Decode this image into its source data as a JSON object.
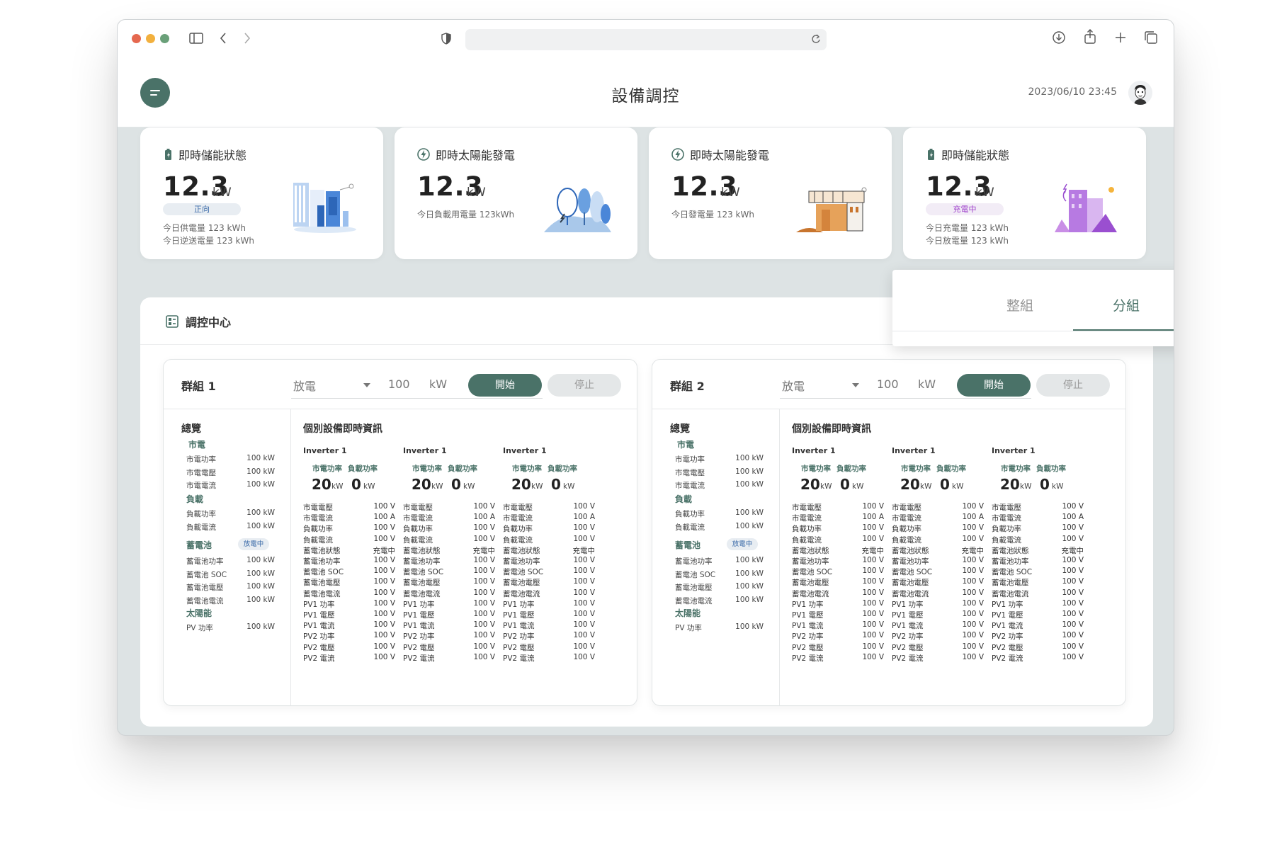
{
  "app": {
    "title": "設備調控",
    "datetime": "2023/06/10 23:45"
  },
  "colors": {
    "accent": "#4a7268",
    "badge_blue": "#3a6aa8",
    "badge_purple": "#a044cc"
  },
  "cards": [
    {
      "title": "即時儲能狀態",
      "icon": "battery-icon",
      "value": "12.3",
      "unit": "kW",
      "badge": "正向",
      "lines": [
        "今日供電量 123 kWh",
        "今日逆送電量 123 kWh"
      ]
    },
    {
      "title": "即時太陽能發電",
      "icon": "lightning-icon",
      "value": "12.3",
      "unit": "kW",
      "badge": "",
      "lines": [
        "今日負載用電量 123kWh"
      ]
    },
    {
      "title": "即時太陽能發電",
      "icon": "lightning-icon",
      "value": "12.3",
      "unit": "kW",
      "badge": "",
      "lines": [
        "今日發電量 123 kWh"
      ]
    },
    {
      "title": "即時儲能狀態",
      "icon": "battery-icon",
      "value": "12.3",
      "unit": "kW",
      "badge": "充電中",
      "lines": [
        "今日充電量 123 kWh",
        "今日放電量 123 kWh"
      ]
    }
  ],
  "panel": {
    "title": "調控中心",
    "tabs": [
      "整組",
      "分組"
    ],
    "active_tab": "分組"
  },
  "groups": [
    {
      "name": "群組 1",
      "mode": "放電",
      "power": "100",
      "unit": "kW",
      "start_label": "開始",
      "stop_label": "停止",
      "overview": {
        "title": "總覽",
        "grid_title": "市電",
        "grid": [
          [
            "市電功率",
            "100 kW"
          ],
          [
            "市電電壓",
            "100 kW"
          ],
          [
            "市電電流",
            "100 kW"
          ]
        ],
        "load_title": "負載",
        "load": [
          [
            "負載功率",
            "100 kW"
          ],
          [
            "負載電流",
            "100 kW"
          ]
        ],
        "battery_title": "蓄電池",
        "battery_badge": "放電中",
        "battery": [
          [
            "蓄電池功率",
            "100 kW"
          ],
          [
            "蓄電池 SOC",
            "100 kW"
          ],
          [
            "蓄電池電壓",
            "100 kW"
          ],
          [
            "蓄電池電流",
            "100 kW"
          ]
        ],
        "solar_title": "太陽能",
        "solar": [
          [
            "PV 功率",
            "100 kW"
          ]
        ]
      },
      "devices_title": "個別設備即時資訊",
      "inverters": [
        {
          "name": "Inverter 1",
          "grid_label": "市電功率",
          "load_label": "負載功率",
          "grid_value": "20",
          "load_value": "0",
          "unit": "kW",
          "rows": [
            [
              "市電電壓",
              "100 V"
            ],
            [
              "市電電流",
              "100 A"
            ],
            [
              "負載功率",
              "100 V"
            ],
            [
              "負載電流",
              "100 V"
            ],
            [
              "蓄電池狀態",
              "充電中"
            ],
            [
              "蓄電池功率",
              "100 V"
            ],
            [
              "蓄電池 SOC",
              "100 V"
            ],
            [
              "蓄電池電壓",
              "100 V"
            ],
            [
              "蓄電池電流",
              "100 V"
            ],
            [
              "PV1 功率",
              "100 V"
            ],
            [
              "PV1 電壓",
              "100 V"
            ],
            [
              "PV1 電流",
              "100 V"
            ],
            [
              "PV2 功率",
              "100 V"
            ],
            [
              "PV2 電壓",
              "100 V"
            ],
            [
              "PV2 電流",
              "100 V"
            ]
          ]
        },
        {
          "name": "Inverter 1",
          "grid_label": "市電功率",
          "load_label": "負載功率",
          "grid_value": "20",
          "load_value": "0",
          "unit": "kW",
          "rows": [
            [
              "市電電壓",
              "100 V"
            ],
            [
              "市電電流",
              "100 A"
            ],
            [
              "負載功率",
              "100 V"
            ],
            [
              "負載電流",
              "100 V"
            ],
            [
              "蓄電池狀態",
              "充電中"
            ],
            [
              "蓄電池功率",
              "100 V"
            ],
            [
              "蓄電池 SOC",
              "100 V"
            ],
            [
              "蓄電池電壓",
              "100 V"
            ],
            [
              "蓄電池電流",
              "100 V"
            ],
            [
              "PV1 功率",
              "100 V"
            ],
            [
              "PV1 電壓",
              "100 V"
            ],
            [
              "PV1 電流",
              "100 V"
            ],
            [
              "PV2 功率",
              "100 V"
            ],
            [
              "PV2 電壓",
              "100 V"
            ],
            [
              "PV2 電流",
              "100 V"
            ]
          ]
        },
        {
          "name": "Inverter 1",
          "grid_label": "市電功率",
          "load_label": "負載功率",
          "grid_value": "20",
          "load_value": "0",
          "unit": "kW",
          "rows": [
            [
              "市電電壓",
              "100 V"
            ],
            [
              "市電電流",
              "100 A"
            ],
            [
              "負載功率",
              "100 V"
            ],
            [
              "負載電流",
              "100 V"
            ],
            [
              "蓄電池狀態",
              "充電中"
            ],
            [
              "蓄電池功率",
              "100 V"
            ],
            [
              "蓄電池 SOC",
              "100 V"
            ],
            [
              "蓄電池電壓",
              "100 V"
            ],
            [
              "蓄電池電流",
              "100 V"
            ],
            [
              "PV1 功率",
              "100 V"
            ],
            [
              "PV1 電壓",
              "100 V"
            ],
            [
              "PV1 電流",
              "100 V"
            ],
            [
              "PV2 功率",
              "100 V"
            ],
            [
              "PV2 電壓",
              "100 V"
            ],
            [
              "PV2 電流",
              "100 V"
            ]
          ]
        }
      ]
    },
    {
      "name": "群組 2",
      "mode": "放電",
      "power": "100",
      "unit": "kW",
      "start_label": "開始",
      "stop_label": "停止",
      "overview": {
        "title": "總覽",
        "grid_title": "市電",
        "grid": [
          [
            "市電功率",
            "100 kW"
          ],
          [
            "市電電壓",
            "100 kW"
          ],
          [
            "市電電流",
            "100 kW"
          ]
        ],
        "load_title": "負載",
        "load": [
          [
            "負載功率",
            "100 kW"
          ],
          [
            "負載電流",
            "100 kW"
          ]
        ],
        "battery_title": "蓄電池",
        "battery_badge": "放電中",
        "battery": [
          [
            "蓄電池功率",
            "100 kW"
          ],
          [
            "蓄電池 SOC",
            "100 kW"
          ],
          [
            "蓄電池電壓",
            "100 kW"
          ],
          [
            "蓄電池電流",
            "100 kW"
          ]
        ],
        "solar_title": "太陽能",
        "solar": [
          [
            "PV 功率",
            "100 kW"
          ]
        ]
      },
      "devices_title": "個別設備即時資訊",
      "inverters": [
        {
          "name": "Inverter 1",
          "grid_label": "市電功率",
          "load_label": "負載功率",
          "grid_value": "20",
          "load_value": "0",
          "unit": "kW",
          "rows": [
            [
              "市電電壓",
              "100 V"
            ],
            [
              "市電電流",
              "100 A"
            ],
            [
              "負載功率",
              "100 V"
            ],
            [
              "負載電流",
              "100 V"
            ],
            [
              "蓄電池狀態",
              "充電中"
            ],
            [
              "蓄電池功率",
              "100 V"
            ],
            [
              "蓄電池 SOC",
              "100 V"
            ],
            [
              "蓄電池電壓",
              "100 V"
            ],
            [
              "蓄電池電流",
              "100 V"
            ],
            [
              "PV1 功率",
              "100 V"
            ],
            [
              "PV1 電壓",
              "100 V"
            ],
            [
              "PV1 電流",
              "100 V"
            ],
            [
              "PV2 功率",
              "100 V"
            ],
            [
              "PV2 電壓",
              "100 V"
            ],
            [
              "PV2 電流",
              "100 V"
            ]
          ]
        },
        {
          "name": "Inverter 1",
          "grid_label": "市電功率",
          "load_label": "負載功率",
          "grid_value": "20",
          "load_value": "0",
          "unit": "kW",
          "rows": [
            [
              "市電電壓",
              "100 V"
            ],
            [
              "市電電流",
              "100 A"
            ],
            [
              "負載功率",
              "100 V"
            ],
            [
              "負載電流",
              "100 V"
            ],
            [
              "蓄電池狀態",
              "充電中"
            ],
            [
              "蓄電池功率",
              "100 V"
            ],
            [
              "蓄電池 SOC",
              "100 V"
            ],
            [
              "蓄電池電壓",
              "100 V"
            ],
            [
              "蓄電池電流",
              "100 V"
            ],
            [
              "PV1 功率",
              "100 V"
            ],
            [
              "PV1 電壓",
              "100 V"
            ],
            [
              "PV1 電流",
              "100 V"
            ],
            [
              "PV2 功率",
              "100 V"
            ],
            [
              "PV2 電壓",
              "100 V"
            ],
            [
              "PV2 電流",
              "100 V"
            ]
          ]
        },
        {
          "name": "Inverter 1",
          "grid_label": "市電功率",
          "load_label": "負載功率",
          "grid_value": "20",
          "load_value": "0",
          "unit": "kW",
          "rows": [
            [
              "市電電壓",
              "100 V"
            ],
            [
              "市電電流",
              "100 A"
            ],
            [
              "負載功率",
              "100 V"
            ],
            [
              "負載電流",
              "100 V"
            ],
            [
              "蓄電池狀態",
              "充電中"
            ],
            [
              "蓄電池功率",
              "100 V"
            ],
            [
              "蓄電池 SOC",
              "100 V"
            ],
            [
              "蓄電池電壓",
              "100 V"
            ],
            [
              "蓄電池電流",
              "100 V"
            ],
            [
              "PV1 功率",
              "100 V"
            ],
            [
              "PV1 電壓",
              "100 V"
            ],
            [
              "PV1 電流",
              "100 V"
            ],
            [
              "PV2 功率",
              "100 V"
            ],
            [
              "PV2 電壓",
              "100 V"
            ],
            [
              "PV2 電流",
              "100 V"
            ]
          ]
        }
      ]
    }
  ]
}
